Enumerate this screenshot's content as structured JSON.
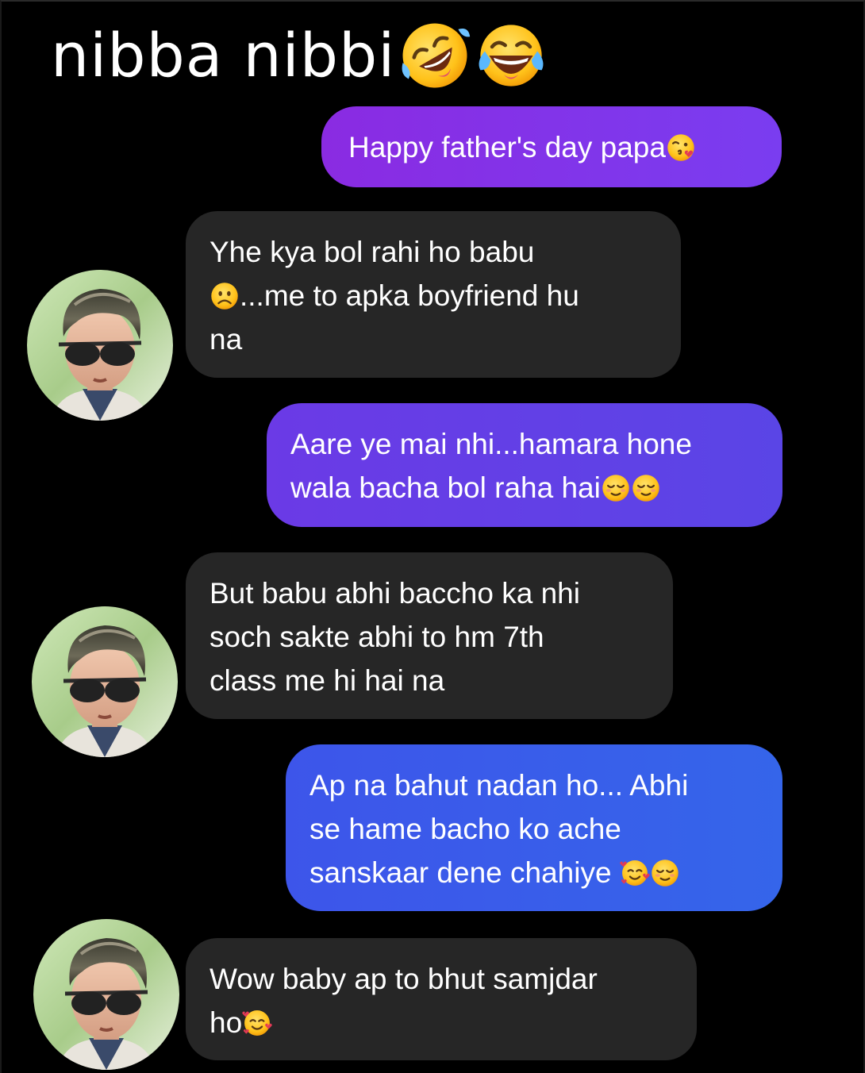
{
  "header": {
    "title": "nibba nibbi",
    "emojis": [
      "rolling-on-floor-laughing-icon",
      "tears-of-joy-icon"
    ]
  },
  "colors": {
    "background": "#000000",
    "received_bubble": "#262626",
    "sent_bubble_purple": "#7b35d8",
    "sent_bubble_indigo": "#5a41e4",
    "sent_bubble_blue": "#3e5fe8"
  },
  "messages": [
    {
      "direction": "sent",
      "lines": [
        "Happy father's day papa"
      ],
      "emojis": [
        "face-blowing-kiss-icon"
      ]
    },
    {
      "direction": "received",
      "lines": [
        "Yhe kya bol rahi ho babu",
        "...me to apka boyfriend hu",
        "na"
      ],
      "emojis": [
        "frowning-face-icon"
      ]
    },
    {
      "direction": "sent",
      "lines": [
        "Aare ye mai nhi...hamara hone",
        "wala bacha bol raha hai"
      ],
      "emojis": [
        "relieved-face-icon",
        "relieved-face-icon"
      ]
    },
    {
      "direction": "received",
      "lines": [
        "But babu abhi baccho ka nhi",
        "soch sakte abhi to hm 7th",
        "class me hi hai na"
      ],
      "emojis": []
    },
    {
      "direction": "sent",
      "lines": [
        "Ap na bahut nadan ho... Abhi",
        "se hame bacho ko ache",
        "sanskaar dene chahiye"
      ],
      "emojis": [
        "smiling-face-with-hearts-icon",
        "relieved-face-icon"
      ]
    },
    {
      "direction": "received",
      "lines": [
        "Wow baby ap to bhut samjdar",
        "ho"
      ],
      "emojis": [
        "smiling-face-with-hearts-icon"
      ]
    }
  ]
}
